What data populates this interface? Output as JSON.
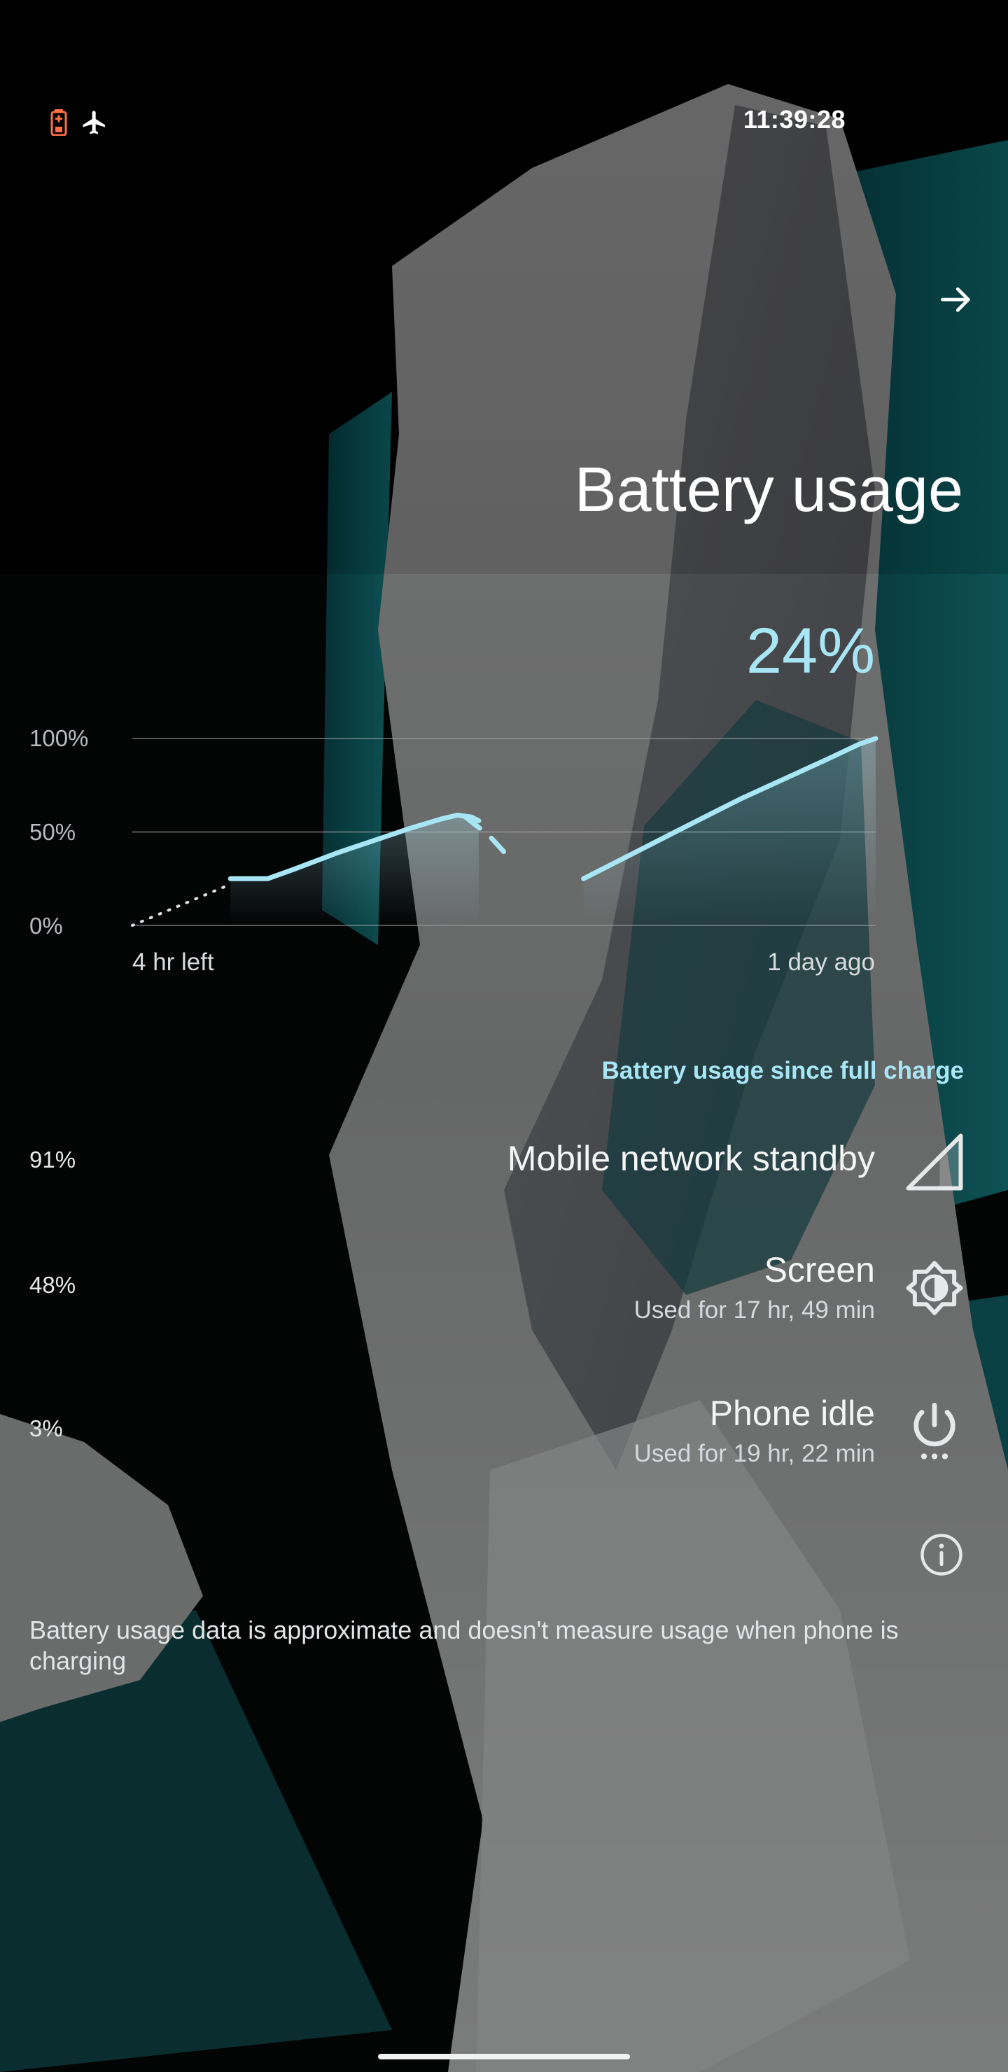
{
  "status_bar": {
    "time": "11:39:28",
    "icons": [
      "battery-saver-icon",
      "airplane-mode-icon"
    ]
  },
  "header": {
    "title": "Battery usage",
    "forward_icon": "arrow-right-icon"
  },
  "battery": {
    "level": "24%"
  },
  "chart_data": {
    "type": "line",
    "y_tick_labels": [
      "100%",
      "50%",
      "0%"
    ],
    "ylim": [
      0,
      100
    ],
    "x_tick_labels": [
      "4 hr left",
      "1 day ago"
    ],
    "grid": true,
    "series": [
      {
        "style": "solid",
        "points": [
          [
            0.132,
            25
          ],
          [
            0.182,
            25
          ],
          [
            0.217,
            30
          ],
          [
            0.277,
            39
          ],
          [
            0.374,
            52
          ],
          [
            0.416,
            57
          ],
          [
            0.437,
            59
          ],
          [
            0.456,
            58
          ],
          [
            0.466,
            56
          ]
        ]
      },
      {
        "style": "dashed",
        "points": [
          [
            0.448,
            58
          ],
          [
            0.48,
            48
          ],
          [
            0.51,
            35
          ]
        ]
      },
      {
        "style": "solid",
        "points": [
          [
            0.607,
            25
          ],
          [
            0.74,
            52
          ],
          [
            0.82,
            68
          ],
          [
            0.93,
            88
          ],
          [
            0.978,
            97
          ],
          [
            1.0,
            100
          ]
        ]
      },
      {
        "style": "dotted",
        "points": [
          [
            0.0,
            0
          ],
          [
            0.132,
            22
          ]
        ]
      }
    ]
  },
  "usage": {
    "section_title": "Battery usage since full charge",
    "items": [
      {
        "percent": "91%",
        "title": "Mobile network standby",
        "subtitle": "",
        "icon": "cellular-signal-icon"
      },
      {
        "percent": "48%",
        "title": "Screen",
        "subtitle": "Used for 17 hr, 49 min",
        "icon": "brightness-icon"
      },
      {
        "percent": "3%",
        "title": "Phone idle",
        "subtitle": "Used for 19 hr, 22 min",
        "icon": "power-idle-icon"
      }
    ]
  },
  "footer": {
    "info_icon": "info-icon",
    "note": "Battery usage data is approximate and doesn't measure usage when phone is charging"
  },
  "colors": {
    "accent": "#a8e6f5",
    "text": "#ffffff",
    "battery_saver": "#ff7043"
  }
}
